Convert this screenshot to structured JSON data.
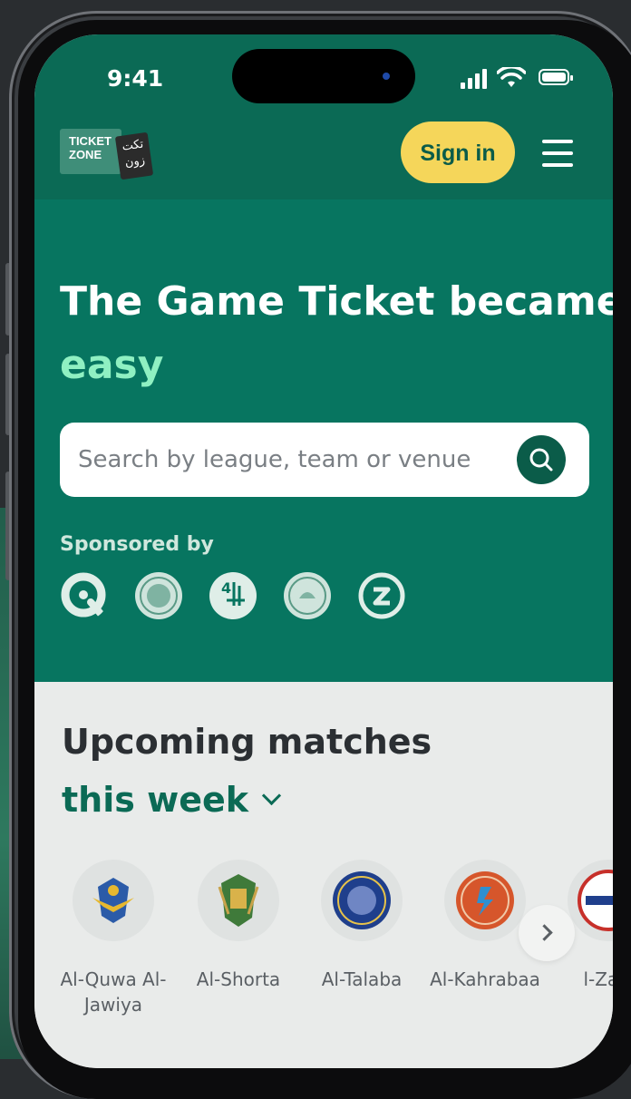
{
  "status_bar": {
    "time": "9:41"
  },
  "header": {
    "logo_text_en_line1": "TICKET",
    "logo_text_en_line2": "ZONE",
    "logo_text_ar_line1": "تكت",
    "logo_text_ar_line2": "زون",
    "signin_label": "Sign in",
    "brand_color": "#0b6a55",
    "signin_color": "#f5d65a"
  },
  "hero": {
    "headline": "The Game Ticket became",
    "headline_accent": "easy",
    "search_placeholder": "Search by league, team or venue",
    "sponsored_label": "Sponsored by",
    "sponsors": [
      "sponsor-q-logo",
      "sponsor-seal-1",
      "sponsor-4-logo",
      "sponsor-seal-2",
      "sponsor-z-logo"
    ]
  },
  "matches": {
    "title": "Upcoming matches",
    "period": "this week",
    "teams": [
      {
        "name": "Al-Quwa Al-Jawiya",
        "color": "#2b5ba8"
      },
      {
        "name": "Al-Shorta",
        "color": "#3f7a3a"
      },
      {
        "name": "Al-Talaba",
        "color": "#1f3f8c"
      },
      {
        "name": "Al-Kahrabaa",
        "color": "#d6562b"
      },
      {
        "name": "l-Zaw",
        "color": "#c7302a"
      }
    ]
  }
}
